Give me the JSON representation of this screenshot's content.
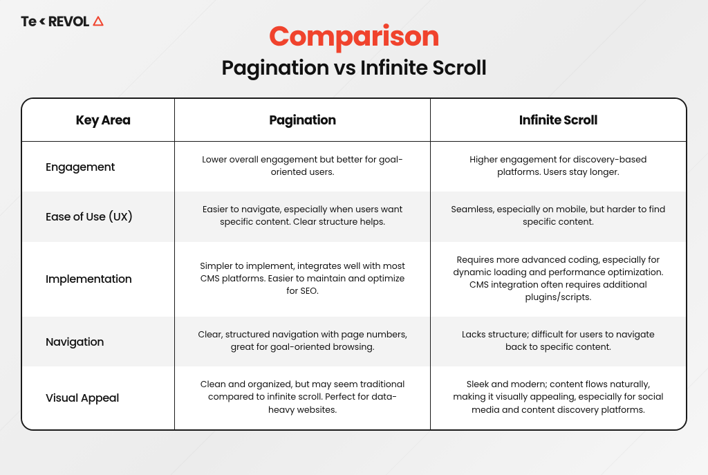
{
  "logo": {
    "text_left": "Te",
    "text_mid": "<",
    "text_right": "REVOL"
  },
  "heading": {
    "title": "Comparison",
    "subtitle": "Pagination vs Infinite Scroll"
  },
  "chart_data": {
    "type": "table",
    "title": "Comparison — Pagination vs Infinite Scroll",
    "columns": [
      "Key Area",
      "Pagination",
      "Infinite Scroll"
    ],
    "rows": [
      {
        "key": "Engagement",
        "pagination": "Lower overall engagement but better for goal-oriented users.",
        "infinite": "Higher engagement for discovery-based platforms. Users stay longer."
      },
      {
        "key": "Ease of Use (UX)",
        "pagination": "Easier to navigate, especially when users want specific content. Clear structure helps.",
        "infinite": "Seamless, especially on mobile, but harder to find specific content."
      },
      {
        "key": "Implementation",
        "pagination": "Simpler to implement, integrates well with most CMS platforms. Easier to maintain and optimize for SEO.",
        "infinite": "Requires more advanced coding, especially for dynamic loading and performance optimization. CMS integration often requires additional plugins/scripts."
      },
      {
        "key": "Navigation",
        "pagination": "Clear, structured navigation with page numbers, great for goal-oriented browsing.",
        "infinite": "Lacks structure; difficult for users to navigate back to specific content."
      },
      {
        "key": "Visual Appeal",
        "pagination": "Clean and organized, but may seem traditional compared to infinite scroll. Perfect for data-heavy websites.",
        "infinite": "Sleek and modern; content flows naturally, making it visually appealing, especially for social media and content discovery platforms."
      }
    ]
  }
}
